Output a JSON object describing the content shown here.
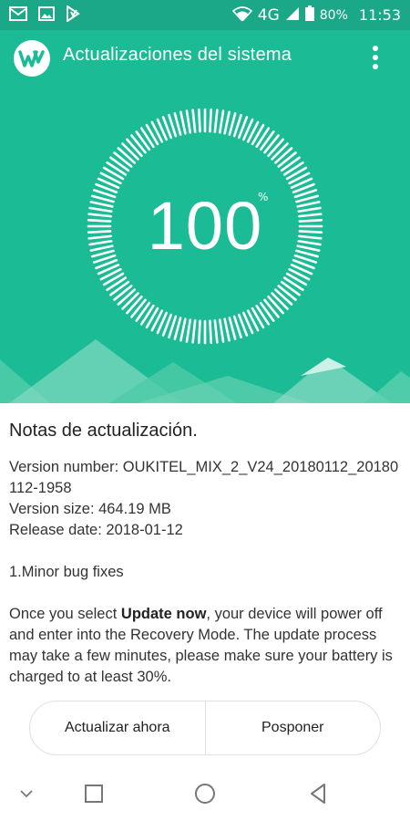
{
  "status_bar": {
    "network": "4G",
    "battery_percent": "80%",
    "time": "11:53",
    "icons": [
      "gmail-icon",
      "gallery-icon",
      "download-app-icon",
      "wifi-icon",
      "signal-icon",
      "battery-icon"
    ]
  },
  "app_bar": {
    "title": "Actualizaciones del sistema",
    "logo_icon": "wave-logo-icon",
    "menu_icon": "more-vert-icon"
  },
  "progress": {
    "value": "100",
    "unit": "%",
    "fraction": 1.0
  },
  "notes": {
    "title": "Notas de actualización.",
    "version_number_line": "Version number: OUKITEL_MIX_2_V24_20180112_20180112-1958",
    "version_size_line": "Version size: 464.19 MB",
    "release_date_line": "Release date: 2018-01-12",
    "changes": "1.Minor bug fixes",
    "instruction_prefix": "Once you select ",
    "instruction_bold": "Update now",
    "instruction_suffix": ", your device will power off and enter into the Recovery Mode. The update process may take a few minutes, please make sure your battery is charged to at least 30%."
  },
  "actions": {
    "update_now": "Actualizar ahora",
    "postpone": "Posponer"
  },
  "nav": {
    "icons": [
      "collapse-icon",
      "recents-icon",
      "home-icon",
      "back-icon"
    ]
  },
  "colors": {
    "hero": "#1bbc95",
    "status_bar": "#1aa888",
    "mountain_light": "#7fd8bf"
  }
}
